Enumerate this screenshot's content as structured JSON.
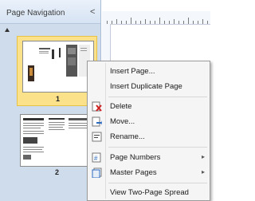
{
  "nav": {
    "title": "Page Navigation",
    "collapse": "<",
    "pages": [
      {
        "number": "1",
        "selected": true
      },
      {
        "number": "2",
        "selected": false
      }
    ]
  },
  "menu": {
    "items": [
      {
        "label": "Insert Page...",
        "icon": "",
        "submenu": false
      },
      {
        "label": "Insert Duplicate Page",
        "icon": "",
        "submenu": false
      },
      {
        "label": "Delete",
        "icon": "delete-page-icon",
        "submenu": false
      },
      {
        "label": "Move...",
        "icon": "move-page-icon",
        "submenu": false
      },
      {
        "label": "Rename...",
        "icon": "rename-page-icon",
        "submenu": false
      },
      {
        "label": "Page Numbers",
        "icon": "page-numbers-icon",
        "submenu": true
      },
      {
        "label": "Master Pages",
        "icon": "master-pages-icon",
        "submenu": true
      },
      {
        "label": "View Two-Page Spread",
        "icon": "",
        "submenu": false
      }
    ],
    "arrow": "▸"
  },
  "colors": {
    "selected_bg": "#fbe28a",
    "pane_bg": "#cfdcec"
  }
}
